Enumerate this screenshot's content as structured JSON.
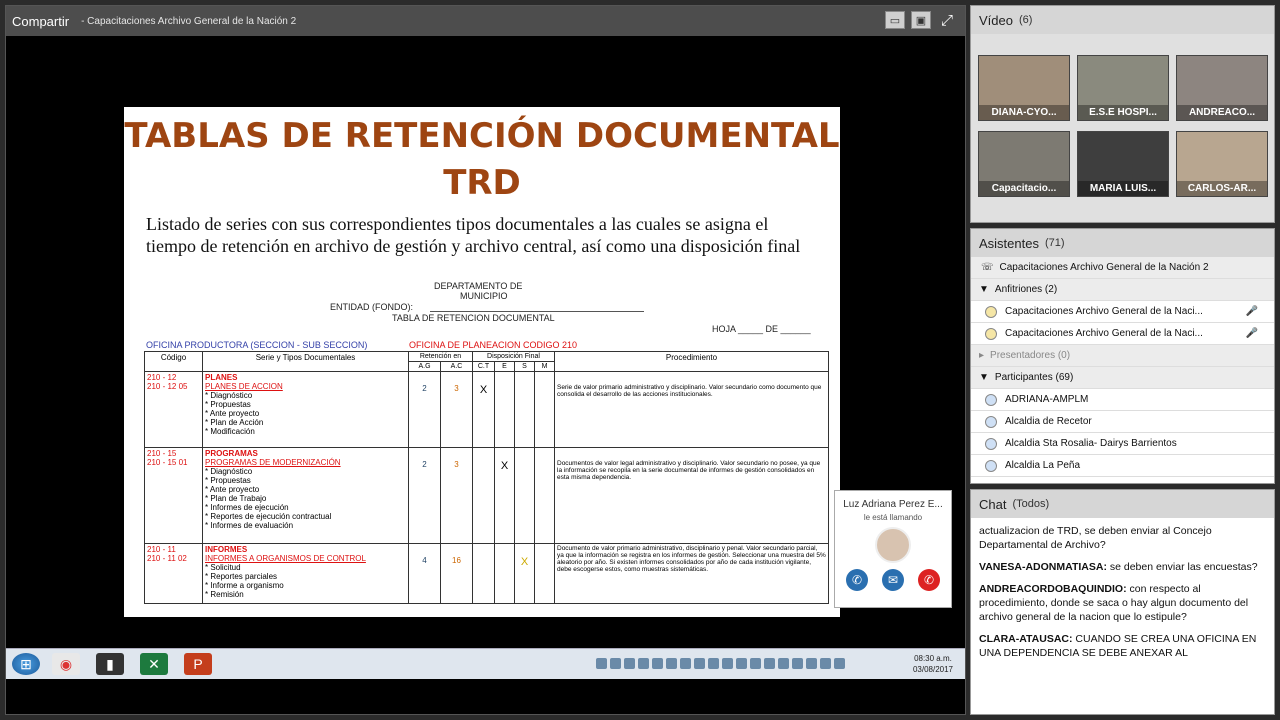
{
  "share": {
    "title": "Compartir",
    "subtitle": "- Capacitaciones Archivo General de la Nación 2"
  },
  "slide": {
    "title_line1": "TABLAS DE RETENCIÓN DOCUMENTAL",
    "title_line2": "TRD",
    "description": "Listado de series con sus correspondientes tipos documentales a las cuales se asigna el tiempo de retención en archivo de gestión y archivo central, así como una disposición final",
    "dept": "DEPARTAMENTO DE",
    "municipio": "MUNICIPIO",
    "entidad": "ENTIDAD (FONDO):",
    "tabla": "TABLA DE RETENCION DOCUMENTAL",
    "hoja": "HOJA _____ DE ______",
    "oficina_productora": "OFICINA PRODUCTORA (SECCION - SUB SECCION)",
    "oficina_planeacion": "OFICINA DE PLANEACION CODIGO 210",
    "headers": {
      "codigo": "Código",
      "serie": "Serie y Tipos Documentales",
      "retencion": "Retención en",
      "disposicion": "Disposición Final",
      "procedimiento": "Procedimiento",
      "ag": "A.G",
      "ac": "A.C",
      "ct": "C.T",
      "e": "E",
      "s": "S",
      "m": "M"
    },
    "rows": [
      {
        "code1": "210 - 12",
        "code2": "210 - 12 05",
        "serie": "PLANES",
        "sub": "PLANES DE ACCION",
        "items": "* Diagnóstico\n* Propuestas\n* Ante proyecto\n* Plan de Acción\n* Modificación",
        "ag": "2",
        "ac": "3",
        "ct": "X",
        "e": "",
        "s": "",
        "proc": "Serie de valor primario administrativo y disciplinario. Valor secundario como documento que consolida el desarrollo de las acciones institucionales."
      },
      {
        "code1": "210 - 15",
        "code2": "210 - 15 01",
        "serie": "PROGRAMAS",
        "sub": "PROGRAMAS DE MODERNIZACIÓN",
        "items": "* Diagnóstico\n* Propuestas\n* Ante proyecto\n* Plan de Trabajo\n* Informes de ejecución\n* Reportes de ejecución contractual\n* Informes de evaluación",
        "ag": "2",
        "ac": "3",
        "ct": "",
        "e": "X",
        "s": "",
        "proc": "Documentos de valor legal administrativo y disciplinario. Valor secundario no posee, ya que la información se recopila en la serie documental de informes de gestión consolidados en esta misma dependencia."
      },
      {
        "code1": "210 - 11",
        "code2": "210 - 11 02",
        "serie": "INFORMES",
        "sub": "INFORMES A ORGANISMOS DE CONTROL",
        "items": "* Solicitud\n* Reportes parciales\n* Informe a organismo\n* Remisión",
        "ag": "4",
        "ac": "16",
        "ct": "",
        "e": "",
        "s": "X",
        "proc": "Documento de valor primario administrativo, disciplinario y penal. Valor secundario parcial, ya que la información se registra en los informes de gestión. Seleccionar una muestra del 5% aleatorio por año. Si existen informes consolidados por año de cada institución vigilante, debe escogerse estos, como muestras sistemáticas."
      }
    ]
  },
  "taskbar": {
    "time": "08:30 a.m.",
    "date": "03/08/2017"
  },
  "call": {
    "name": "Luz Adriana Perez E...",
    "status": "le está llamando"
  },
  "video": {
    "title": "Vídeo",
    "count": "(6)",
    "tiles": [
      "DIANA-CYO...",
      "E.S.E HOSPI...",
      "ANDREACO...",
      "Capacitacio...",
      "MARIA LUIS...",
      "CARLOS-AR..."
    ]
  },
  "attendees": {
    "title": "Asistentes",
    "count": "(71)",
    "session": "Capacitaciones Archivo General de la Nación 2",
    "hosts_label": "Anfitriones (2)",
    "hosts": [
      "Capacitaciones Archivo General de la Naci...",
      "Capacitaciones Archivo General de la Naci..."
    ],
    "presenters_label": "Presentadores (0)",
    "participants_label": "Participantes (69)",
    "participants": [
      "ADRIANA-AMPLM",
      "Alcaldia de Recetor",
      "Alcaldia Sta Rosalia- Dairys Barrientos",
      "Alcaldia La Peña"
    ]
  },
  "chat": {
    "title": "Chat",
    "scope": "(Todos)",
    "messages": [
      {
        "author": "",
        "text": "actualizacion de TRD, se deben enviar al Concejo Departamental de Archivo?"
      },
      {
        "author": "VANESA-ADONMATIASA:",
        "text": " se deben enviar las encuestas?"
      },
      {
        "author": "ANDREACORDOBAQUINDIO:",
        "text": " con respecto al procedimiento, donde se saca o hay algun documento del archivo general de la nacion que lo estipule?"
      },
      {
        "author": "CLARA-ATAUSAC:",
        "text": " CUANDO SE CREA UNA OFICINA EN UNA DEPENDENCIA SE DEBE ANEXAR AL"
      }
    ]
  },
  "colors": {
    "title_brown": "#9e4512",
    "red": "#dd1111",
    "panel_header": "#d6d6d6"
  }
}
